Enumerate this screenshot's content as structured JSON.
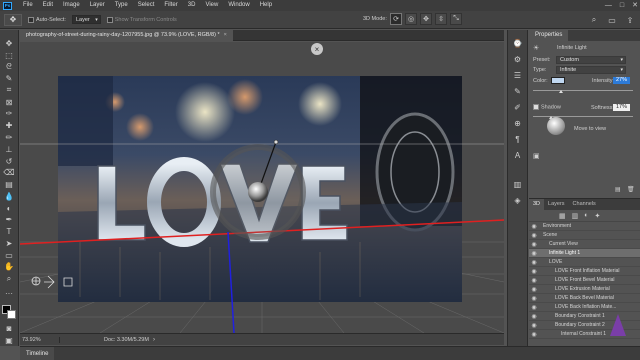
{
  "app": {
    "logo_text": "Ps"
  },
  "menu": [
    "File",
    "Edit",
    "Image",
    "Layer",
    "Type",
    "Select",
    "Filter",
    "3D",
    "View",
    "Window",
    "Help"
  ],
  "window_controls": {
    "minimize": "—",
    "maximize": "□",
    "close": "✕"
  },
  "options": {
    "auto_select_label": "Auto-Select:",
    "auto_select_value": "Layer",
    "transform_label": "Show Transform Controls",
    "mode_label": "3D Mode:"
  },
  "document": {
    "tab_title": "photography-of-street-during-rainy-day-1207955.jpg @ 73.9% (LOVE, RGB/8) *",
    "close_glyph": "×",
    "overlay_close": "×",
    "image_text": "LOVE"
  },
  "status": {
    "zoom": "73.92%",
    "doc": "Doc: 3.30M/5.29M",
    "arrow": "›"
  },
  "timeline": {
    "label": "Timeline"
  },
  "properties": {
    "tab": "Properties",
    "header": "Infinite Light",
    "preset_label": "Preset:",
    "preset_value": "Custom",
    "type_label": "Type:",
    "type_value": "Infinite",
    "color_label": "Color:",
    "color_value": "#c0d7f0",
    "intensity_label": "Intensity:",
    "intensity_value": "27%",
    "shadow_label": "Shadow",
    "softness_label": "Softness:",
    "softness_value": "17%",
    "move_label": "Move to view"
  },
  "layers_panel": {
    "tabs": [
      "3D",
      "Layers",
      "Channels"
    ],
    "rows": [
      {
        "label": "Environment",
        "indent": 0,
        "selected": false
      },
      {
        "label": "Scene",
        "indent": 0,
        "selected": false
      },
      {
        "label": "Current View",
        "indent": 1,
        "selected": false
      },
      {
        "label": "Infinite Light 1",
        "indent": 1,
        "selected": true
      },
      {
        "label": "LOVE",
        "indent": 1,
        "selected": false
      },
      {
        "label": "LOVE Front Inflation Material",
        "indent": 2,
        "selected": false
      },
      {
        "label": "LOVE Front Bevel Material",
        "indent": 2,
        "selected": false
      },
      {
        "label": "LOVE Extrusion Material",
        "indent": 2,
        "selected": false
      },
      {
        "label": "LOVE Back Bevel Material",
        "indent": 2,
        "selected": false
      },
      {
        "label": "LOVE Back Inflation Mate...",
        "indent": 2,
        "selected": false
      },
      {
        "label": "Boundary Constraint 1",
        "indent": 2,
        "selected": false
      },
      {
        "label": "Boundary Constraint 2",
        "indent": 2,
        "selected": false
      },
      {
        "label": "Internal Constraint 1",
        "indent": 3,
        "selected": false
      }
    ]
  },
  "colors": {
    "accent": "#31a8ff",
    "selection": "#2d7bd8",
    "axis_x": "#e02020",
    "axis_y": "#2020e0"
  }
}
